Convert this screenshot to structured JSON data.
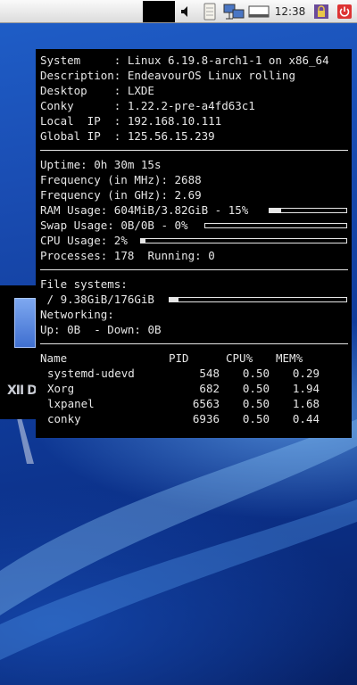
{
  "taskbar": {
    "clock": "12:38",
    "icons": [
      "volume-icon",
      "notes-icon",
      "network-icon",
      "terminal-icon",
      "lock-icon",
      "power-icon"
    ]
  },
  "desktop": {
    "partial_text": "XII D"
  },
  "conky": {
    "system": {
      "system": {
        "label": "System     :",
        "value": "Linux 6.19.8-arch1-1 on x86_64"
      },
      "description": {
        "label": "Description:",
        "value": "EndeavourOS Linux rolling"
      },
      "desktop": {
        "label": "Desktop    :",
        "value": "LXDE"
      },
      "conky": {
        "label": "Conky      :",
        "value": "1.22.2-pre-a4fd63c1"
      },
      "local_ip": {
        "label": "Local  IP  :",
        "value": "192.168.10.111"
      },
      "global_ip": {
        "label": "Global IP  :",
        "value": "125.56.15.239"
      }
    },
    "stats": {
      "uptime": {
        "label": "Uptime:",
        "value": "0h 30m 15s"
      },
      "freq_mhz": {
        "label": "Frequency (in MHz):",
        "value": "2688"
      },
      "freq_ghz": {
        "label": "Frequency (in GHz):",
        "value": "2.69"
      },
      "ram": {
        "label": "RAM Usage:",
        "value": "604MiB/3.82GiB - 15%",
        "fraction": 0.15
      },
      "swap": {
        "label": "Swap Usage:",
        "value": "0B/0B - 0%",
        "fraction": 0.0
      },
      "cpu": {
        "label": "CPU Usage:",
        "value": "2%",
        "fraction": 0.02
      },
      "processes": {
        "label": "Processes:",
        "value": "178",
        "running_label": "Running:",
        "running_value": "0"
      }
    },
    "fs": {
      "title": "File systems:",
      "root": {
        "label": " /",
        "value": "9.38GiB/176GiB",
        "fraction": 0.053
      }
    },
    "net": {
      "title": "Networking:",
      "up_label": "Up:",
      "up_value": "0B",
      "down_label": "- Down:",
      "down_value": "0B"
    },
    "procs": {
      "headers": {
        "name": "Name",
        "pid": "PID",
        "cpu": "CPU%",
        "mem": "MEM%"
      },
      "rows": [
        {
          "name": "systemd-udevd",
          "pid": "548",
          "cpu": "0.50",
          "mem": "0.29"
        },
        {
          "name": "Xorg",
          "pid": "682",
          "cpu": "0.50",
          "mem": "1.94"
        },
        {
          "name": "lxpanel",
          "pid": "6563",
          "cpu": "0.50",
          "mem": "1.68"
        },
        {
          "name": "conky",
          "pid": "6936",
          "cpu": "0.50",
          "mem": "0.44"
        }
      ]
    }
  },
  "colors": {
    "conky_bg": "#000000",
    "conky_fg": "#e6e6e6",
    "wallpaper_blue": "#1a4db3"
  }
}
